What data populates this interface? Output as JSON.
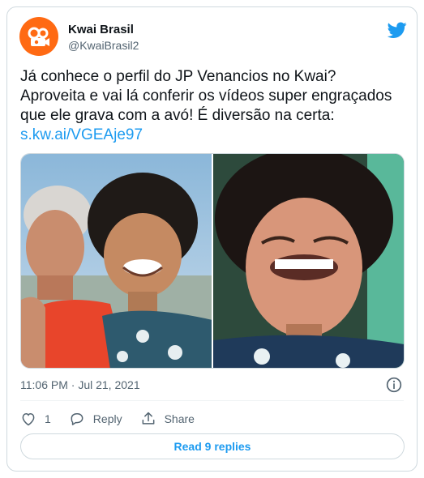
{
  "author": {
    "display_name": "Kwai Brasil",
    "handle": "@KwaiBrasil2",
    "avatar_color": "#ff6a13"
  },
  "tweet": {
    "text": "Já conhece o perfil do JP Venancios no Kwai? Aproveita e vai lá conferir os vídeos super engraçados que ele grava com a avó! É diversão na certa: ",
    "link": "s.kw.ai/VGEAje97",
    "timestamp": "11:06 PM · Jul 21, 2021"
  },
  "actions": {
    "like_count": "1",
    "reply_label": "Reply",
    "share_label": "Share"
  },
  "read_replies_label": "Read 9 replies",
  "colors": {
    "accent": "#1d9bf0",
    "secondary_text": "#536471",
    "border": "#cfd9de"
  },
  "icons": [
    "twitter-bird-icon",
    "info-icon",
    "heart-icon",
    "reply-bubble-icon",
    "share-icon"
  ]
}
